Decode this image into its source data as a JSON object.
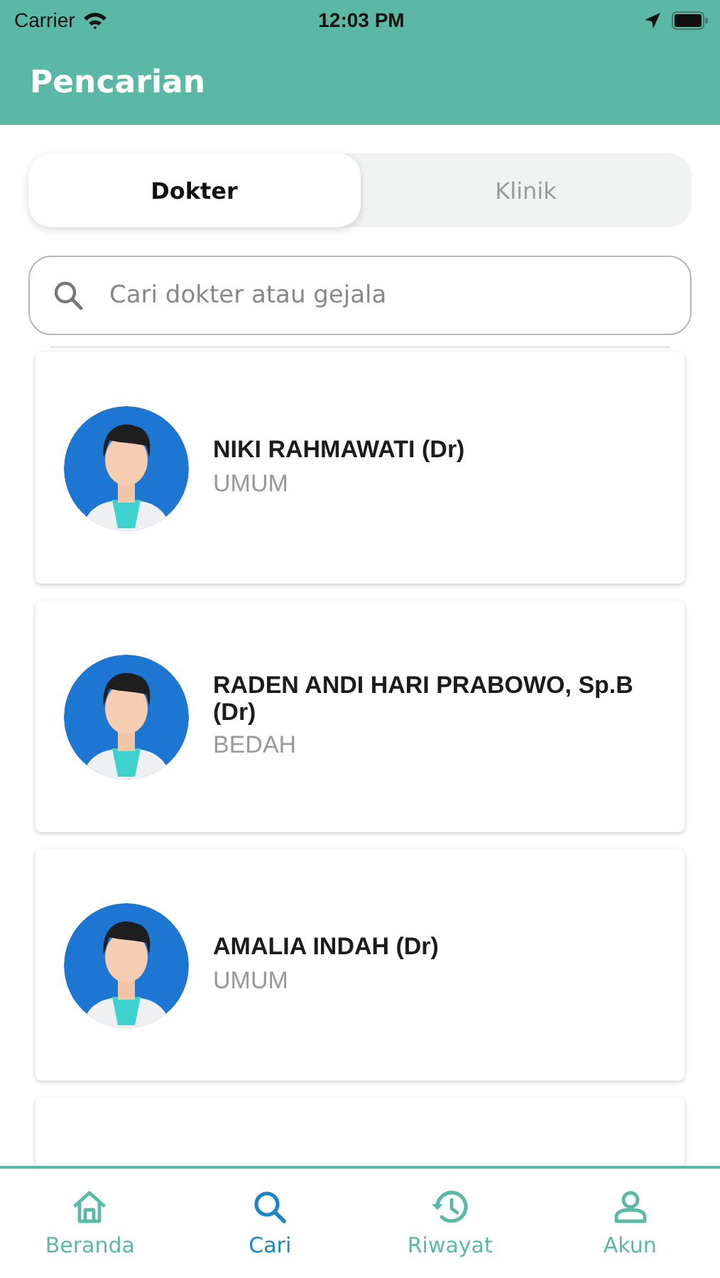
{
  "status_bar": {
    "carrier": "Carrier",
    "time": "12:03 PM"
  },
  "header": {
    "title": "Pencarian"
  },
  "tabs": [
    {
      "label": "Dokter",
      "selected": true
    },
    {
      "label": "Klinik",
      "selected": false
    }
  ],
  "search": {
    "placeholder": "Cari dokter atau gejala"
  },
  "doctors": [
    {
      "name": "NIKI RAHMAWATI (Dr)",
      "specialty": "UMUM"
    },
    {
      "name": "RADEN ANDI HARI PRABOWO, Sp.B (Dr)",
      "specialty": "BEDAH"
    },
    {
      "name": "AMALIA INDAH (Dr)",
      "specialty": "UMUM"
    }
  ],
  "bottom_nav": [
    {
      "kind": "home",
      "label": "Beranda",
      "selected": false
    },
    {
      "kind": "search",
      "label": "Cari",
      "selected": true
    },
    {
      "kind": "history",
      "label": "Riwayat",
      "selected": false
    },
    {
      "kind": "account",
      "label": "Akun",
      "selected": false
    }
  ]
}
